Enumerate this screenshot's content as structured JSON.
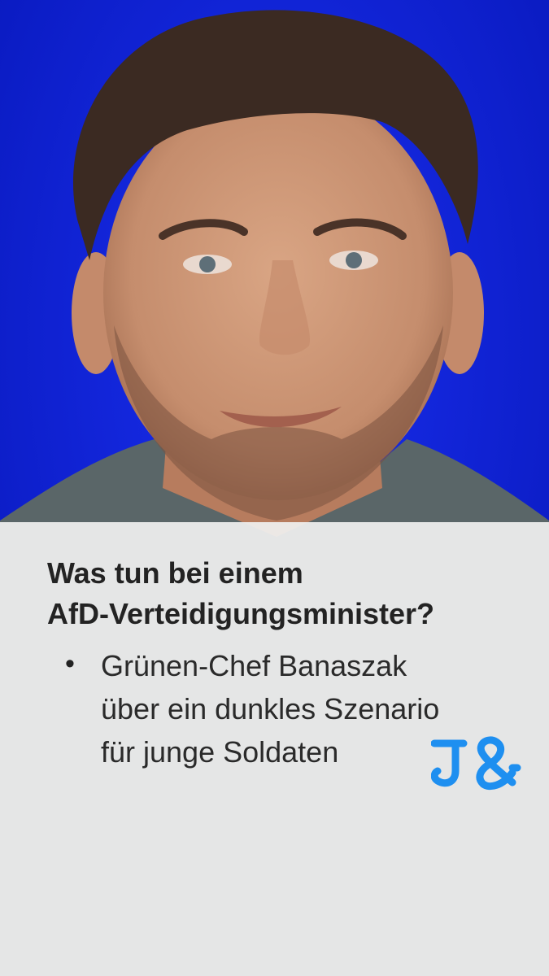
{
  "headline": {
    "line1": "Was tun bei einem",
    "line2": "AfD-Verteidigungsminister?"
  },
  "bullet": {
    "symbol": "•",
    "line1": "Grünen-Chef Banaszak",
    "line2": "über ein dunkles Szenario",
    "line3": "für junge Soldaten"
  },
  "logo": {
    "icon": "j-and-ampersand-logo",
    "color": "#1e8ff0"
  },
  "colors": {
    "background_blue": "#0b1fd8",
    "panel": "#f0f0f0",
    "text": "#232323"
  }
}
